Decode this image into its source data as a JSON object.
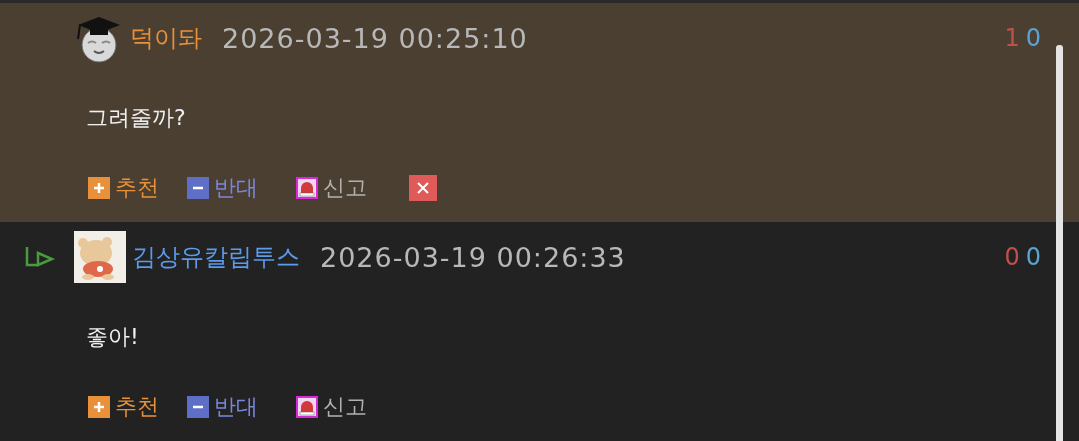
{
  "comments": [
    {
      "reply": false,
      "highlighted": true,
      "avatar": {
        "kind": "icon"
      },
      "author": "덕이돠",
      "color": "#e8913a",
      "time": "2026-03-19 00:25:10",
      "up_count": "1",
      "down_count": "0",
      "body": "그려줄까?",
      "actions": {
        "recommend": "추천",
        "oppose": "반대",
        "report": "신고",
        "delete": true
      }
    },
    {
      "reply": true,
      "highlighted": false,
      "author": "김상유칼립투스",
      "color": "#5b9bea",
      "time": "2026-03-19 00:26:33",
      "up_count": "0",
      "down_count": "0",
      "body": "좋아!",
      "actions": {
        "recommend": "추천",
        "oppose": "반대",
        "report": "신고",
        "delete": false
      }
    }
  ]
}
